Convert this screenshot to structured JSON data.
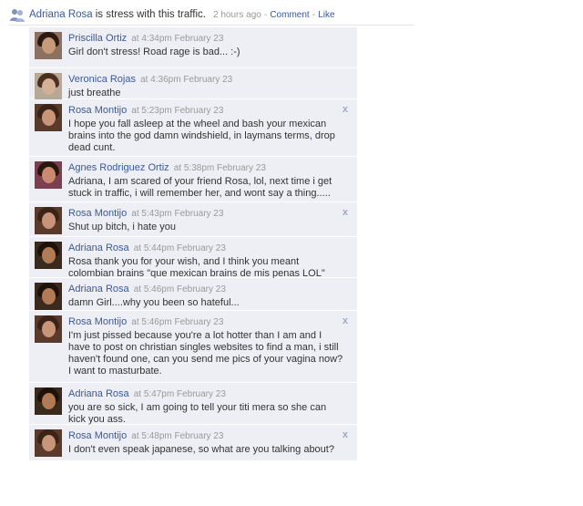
{
  "status": {
    "name": "Adriana Rosa",
    "text": "is stress with this traffic.",
    "time": "2 hours ago",
    "sep1": "-",
    "comment_link": "Comment",
    "sep2": "-",
    "like_link": "Like"
  },
  "comments": [
    {
      "name": "Priscilla Ortiz",
      "time": "at 4:34pm February 23",
      "text": "Girl don't stress! Road rage is bad... :-)",
      "deletable": false,
      "skin": "#c79a7a",
      "hair": "#2b1a12",
      "bg": "#8c7060"
    },
    {
      "name": "Veronica Rojas",
      "time": "at 4:36pm February 23",
      "text": "just breathe",
      "deletable": false,
      "skin": "#d4b096",
      "hair": "#4a3020",
      "bg": "#b8a898"
    },
    {
      "name": "Rosa Montijo",
      "time": "at 5:23pm February 23",
      "text": "I hope you fall asleep at the wheel and bash your mexican brains into the god damn windshield, in laymans terms, drop dead cunt.",
      "deletable": true,
      "skin": "#c9957a",
      "hair": "#3a2418",
      "bg": "#5a3a2a"
    },
    {
      "name": "Agnes Rodriguez Ortiz",
      "time": "at 5:38pm February 23",
      "text": "Adriana, I am scared of your friend Rosa, lol, next time i get stuck in traffic, i will remember her, and wont say a thing.....",
      "deletable": false,
      "skin": "#c98a70",
      "hair": "#2a1810",
      "bg": "#7a4050"
    },
    {
      "name": "Rosa Montijo",
      "time": "at 5:43pm February 23",
      "text": "Shut up bitch, i hate you",
      "deletable": true,
      "skin": "#c9957a",
      "hair": "#3a2418",
      "bg": "#5a3a2a"
    },
    {
      "name": "Adriana Rosa",
      "time": "at 5:44pm February 23",
      "text": "Rosa thank you for your wish, and I think you meant colombian brains \"que mexican brains de mis penas LOL\"",
      "deletable": false,
      "skin": "#b27a55",
      "hair": "#1e120a",
      "bg": "#3a2a1e"
    },
    {
      "name": "Adriana Rosa",
      "time": "at 5:46pm February 23",
      "text": "damn Girl....why you been so hateful...",
      "deletable": false,
      "skin": "#b27a55",
      "hair": "#1e120a",
      "bg": "#3a2a1e"
    },
    {
      "name": "Rosa Montijo",
      "time": "at 5:46pm February 23",
      "text": "I'm just pissed because you're a lot hotter than I am and I have to post on christian singles websites to find a man, i still haven't found one, can you send me pics of your vagina now? I want to masturbate.",
      "deletable": true,
      "skin": "#c9957a",
      "hair": "#3a2418",
      "bg": "#5a3a2a"
    },
    {
      "name": "Adriana Rosa",
      "time": "at 5:47pm February 23",
      "text": "you are so sick, I am going to tell your titi mera so she can kick you ass.",
      "deletable": false,
      "skin": "#b27a55",
      "hair": "#1e120a",
      "bg": "#3a2a1e"
    },
    {
      "name": "Rosa Montijo",
      "time": "at 5:48pm February 23",
      "text": "I don't even speak japanese, so what are you talking about?",
      "deletable": true,
      "skin": "#c9957a",
      "hair": "#3a2418",
      "bg": "#5a3a2a"
    }
  ],
  "colors": {
    "link": "#3b5998",
    "comment_bg": "#edeff4",
    "meta": "#999999"
  },
  "icons": {
    "status": "people-icon",
    "delete": "close-icon"
  },
  "delete_glyph": "x"
}
